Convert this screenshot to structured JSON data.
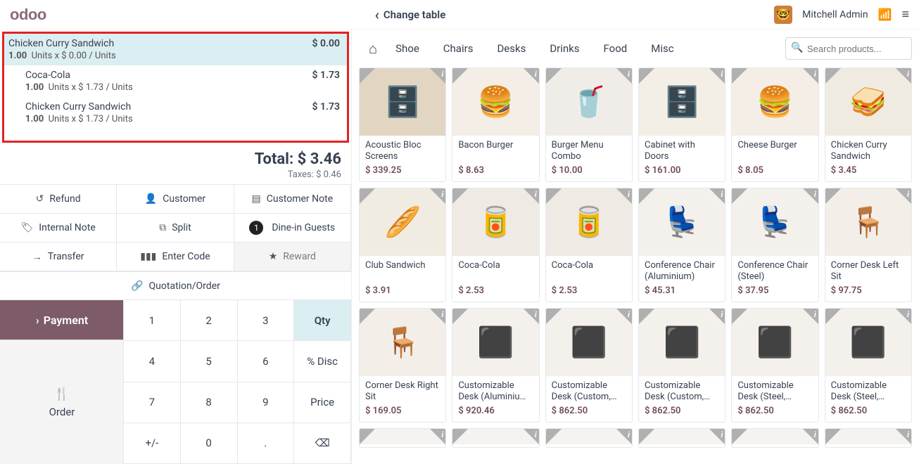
{
  "header": {
    "brand": "odoo",
    "change_table": "Change table",
    "user": "Mitchell Admin"
  },
  "order": {
    "lines": [
      {
        "name": "Chicken Curry Sandwich",
        "qty": "1.00",
        "unit_price": "$ 0.00",
        "unit": "Units",
        "line_total": "$ 0.00",
        "selected": true
      },
      {
        "name": "Coca-Cola",
        "qty": "1.00",
        "unit_price": "$ 1.73",
        "unit": "Units",
        "line_total": "$ 1.73",
        "selected": false
      },
      {
        "name": "Chicken Curry Sandwich",
        "qty": "1.00",
        "unit_price": "$ 1.73",
        "unit": "Units",
        "line_total": "$ 1.73",
        "selected": false
      }
    ],
    "total_label": "Total:",
    "total_value": "$ 3.46",
    "taxes_label": "Taxes:",
    "taxes_value": "$ 0.46"
  },
  "actions": {
    "refund": "Refund",
    "customer": "Customer",
    "customer_note": "Customer Note",
    "internal_note": "Internal Note",
    "split": "Split",
    "guests_count": "1",
    "guests_label": "Dine-in Guests",
    "transfer": "Transfer",
    "enter_code": "Enter Code",
    "reward": "Reward",
    "quotation": "Quotation/Order"
  },
  "bottom": {
    "payment": "Payment",
    "order": "Order",
    "keys": [
      "1",
      "2",
      "3",
      "Qty",
      "4",
      "5",
      "6",
      "% Disc",
      "7",
      "8",
      "9",
      "Price",
      "+/-",
      "0",
      ".",
      "⌫"
    ],
    "selected_key_index": 3
  },
  "categories": [
    "Shoe",
    "Chairs",
    "Desks",
    "Drinks",
    "Food",
    "Misc"
  ],
  "search": {
    "placeholder": "Search products..."
  },
  "products": [
    {
      "name": "Acoustic Bloc Screens",
      "price": "$ 339.25",
      "bg": "#e2d6c3",
      "emoji": "🗄️"
    },
    {
      "name": "Bacon Burger",
      "price": "$ 8.63",
      "bg": "#f4eee6",
      "emoji": "🍔"
    },
    {
      "name": "Burger Menu Combo",
      "price": "$ 10.00",
      "bg": "#f0ede8",
      "emoji": "🥤"
    },
    {
      "name": "Cabinet with Doors",
      "price": "$ 161.00",
      "bg": "#f4efe6",
      "emoji": "🗄️"
    },
    {
      "name": "Cheese Burger",
      "price": "$ 8.05",
      "bg": "#f4eee6",
      "emoji": "🍔"
    },
    {
      "name": "Chicken Curry Sandwich",
      "price": "$ 3.45",
      "bg": "#f0ebe1",
      "emoji": "🥪"
    },
    {
      "name": "Club Sandwich",
      "price": "$ 3.91",
      "bg": "#f1ece2",
      "emoji": "🥖"
    },
    {
      "name": "Coca-Cola",
      "price": "$ 2.53",
      "bg": "#efeae3",
      "emoji": "🥫"
    },
    {
      "name": "Coca-Cola",
      "price": "$ 2.53",
      "bg": "#efeae3",
      "emoji": "🥫"
    },
    {
      "name": "Conference Chair (Aluminium)",
      "price": "$ 45.31",
      "bg": "#f4f1ec",
      "emoji": "💺"
    },
    {
      "name": "Conference Chair (Steel)",
      "price": "$ 37.95",
      "bg": "#f4f1ec",
      "emoji": "💺"
    },
    {
      "name": "Corner Desk Left Sit",
      "price": "$ 97.75",
      "bg": "#f3efe8",
      "emoji": "🪑"
    },
    {
      "name": "Corner Desk Right Sit",
      "price": "$ 169.05",
      "bg": "#f3efe8",
      "emoji": "🪑"
    },
    {
      "name": "Customizable Desk (Aluminiu…",
      "price": "$ 920.46",
      "bg": "#f4f1ec",
      "emoji": "⬛"
    },
    {
      "name": "Customizable Desk (Custom,…",
      "price": "$ 862.50",
      "bg": "#f4f1ec",
      "emoji": "⬛"
    },
    {
      "name": "Customizable Desk (Custom,…",
      "price": "$ 862.50",
      "bg": "#f4f1ec",
      "emoji": "⬛"
    },
    {
      "name": "Customizable Desk (Steel,…",
      "price": "$ 862.50",
      "bg": "#f4f1ec",
      "emoji": "⬛"
    },
    {
      "name": "Customizable Desk (Steel,…",
      "price": "$ 862.50",
      "bg": "#f4f1ec",
      "emoji": "⬛"
    }
  ]
}
